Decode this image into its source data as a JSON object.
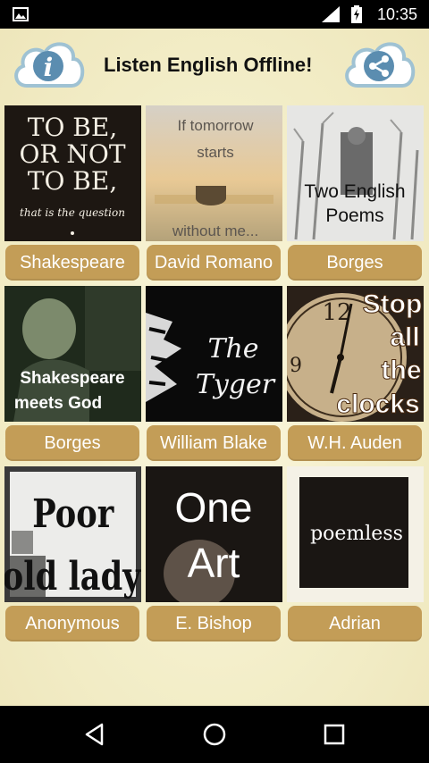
{
  "status_bar": {
    "time": "10:35",
    "icons": [
      "image-notification-icon",
      "signal-icon",
      "battery-charging-icon"
    ]
  },
  "header": {
    "title": "Listen English Offline!",
    "info_icon": "info-cloud-icon",
    "share_icon": "share-cloud-icon"
  },
  "poems": [
    {
      "author": "Shakespeare",
      "cover_lines": [
        "TO BE,",
        "OR NOT",
        "TO BE,",
        "that is the question"
      ]
    },
    {
      "author": "David Romano",
      "cover_lines": [
        "If tomorrow",
        "starts",
        "without me..."
      ]
    },
    {
      "author": "Borges",
      "cover_lines": [
        "Two English",
        "Poems"
      ]
    },
    {
      "author": "Borges",
      "cover_lines": [
        "Shakespeare",
        "meets God"
      ]
    },
    {
      "author": "William Blake",
      "cover_lines": [
        "The",
        "Tyger"
      ]
    },
    {
      "author": "W.H. Auden",
      "cover_lines": [
        "Stop",
        "all",
        "the",
        "clocks"
      ]
    },
    {
      "author": "Anonymous",
      "cover_lines": [
        "Poor",
        "old lady"
      ]
    },
    {
      "author": "E. Bishop",
      "cover_lines": [
        "One",
        "Art"
      ]
    },
    {
      "author": "Adrian",
      "cover_lines": [
        "poemless"
      ]
    }
  ],
  "colors": {
    "background": "#f1ebc4",
    "label_button": "#c39d57",
    "status_bar": "#000000",
    "nav_bar": "#000000"
  },
  "nav_bar": {
    "icons": [
      "back-icon",
      "home-icon",
      "recents-icon"
    ]
  }
}
